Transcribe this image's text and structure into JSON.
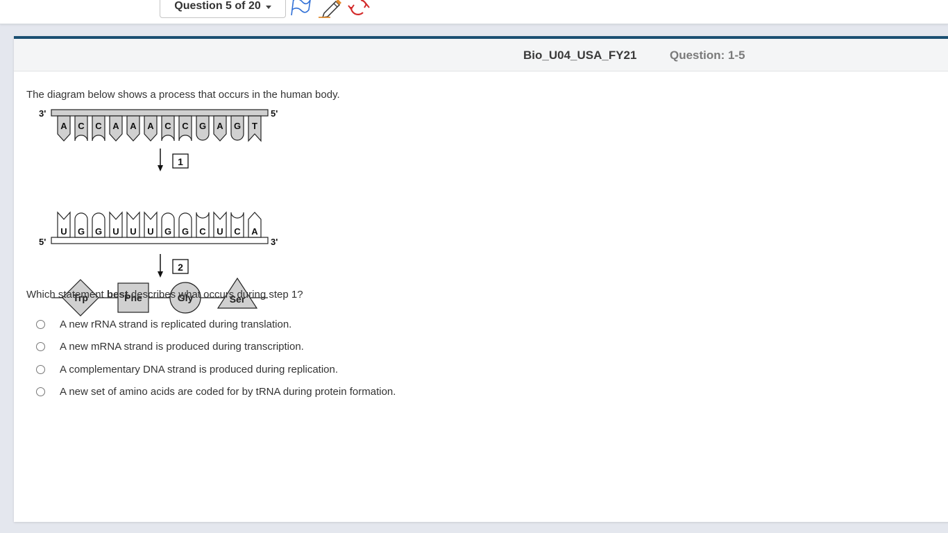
{
  "toolbar": {
    "question_selector": "Question 5 of 20"
  },
  "header": {
    "test_name": "Bio_U04_USA_FY21",
    "question_label": "Question: 1-5"
  },
  "question": {
    "intro": "The diagram below shows a process that occurs in the human body.",
    "prompt_before": "Which statement ",
    "prompt_bold": "best",
    "prompt_after": " describes what occurs during step 1?",
    "choices": [
      "A new rRNA strand is replicated during translation.",
      "A new mRNA strand is produced during transcription.",
      "A complementary DNA strand is produced during replication.",
      "A new set of amino acids are coded for by tRNA during protein formation."
    ]
  },
  "diagram": {
    "dna_end_left": "3'",
    "dna_end_right": "5'",
    "dna_bases": [
      "A",
      "C",
      "C",
      "A",
      "A",
      "A",
      "C",
      "C",
      "G",
      "A",
      "G",
      "T"
    ],
    "step1_label": "1",
    "mrna_end_left": "5'",
    "mrna_end_right": "3'",
    "mrna_bases": [
      "U",
      "G",
      "G",
      "U",
      "U",
      "U",
      "G",
      "G",
      "C",
      "U",
      "C",
      "A"
    ],
    "step2_label": "2",
    "amino_acids": [
      "Trp",
      "Phe",
      "Gly",
      "Ser"
    ]
  },
  "colors": {
    "accent_bar": "#1a4f72",
    "flag": "#2f6fd6",
    "pencil": "#e08a2c",
    "refresh": "#d32b2b",
    "base_fill": "#d0d0d0"
  }
}
